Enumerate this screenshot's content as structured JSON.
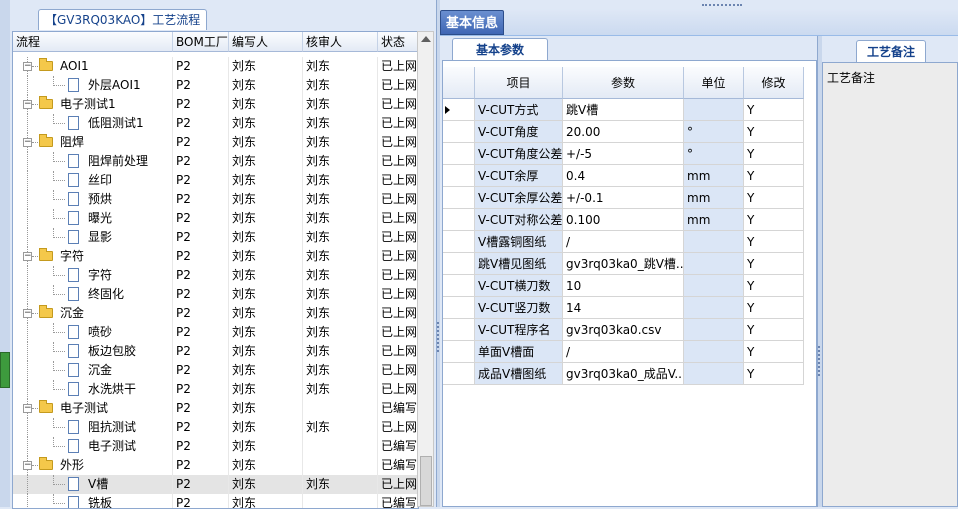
{
  "left_panel": {
    "tab_title": "【GV3RQ03KAO】工艺流程",
    "columns": [
      "流程",
      "BOM工厂",
      "编写人",
      "核审人",
      "状态"
    ],
    "rows": [
      {
        "label": "AOI1",
        "level": 1,
        "type": "folder",
        "bom": "P2",
        "author": "刘东",
        "reviewer": "刘东",
        "status": "已上网"
      },
      {
        "label": "外层AOI1",
        "level": 2,
        "type": "doc",
        "bom": "P2",
        "author": "刘东",
        "reviewer": "刘东",
        "status": "已上网"
      },
      {
        "label": "电子测试1",
        "level": 1,
        "type": "folder",
        "bom": "P2",
        "author": "刘东",
        "reviewer": "刘东",
        "status": "已上网"
      },
      {
        "label": "低阻测试1",
        "level": 2,
        "type": "doc",
        "bom": "P2",
        "author": "刘东",
        "reviewer": "刘东",
        "status": "已上网"
      },
      {
        "label": "阻焊",
        "level": 1,
        "type": "folder",
        "bom": "P2",
        "author": "刘东",
        "reviewer": "刘东",
        "status": "已上网"
      },
      {
        "label": "阻焊前处理",
        "level": 2,
        "type": "doc",
        "bom": "P2",
        "author": "刘东",
        "reviewer": "刘东",
        "status": "已上网"
      },
      {
        "label": "丝印",
        "level": 2,
        "type": "doc",
        "bom": "P2",
        "author": "刘东",
        "reviewer": "刘东",
        "status": "已上网"
      },
      {
        "label": "预烘",
        "level": 2,
        "type": "doc",
        "bom": "P2",
        "author": "刘东",
        "reviewer": "刘东",
        "status": "已上网"
      },
      {
        "label": "曝光",
        "level": 2,
        "type": "doc",
        "bom": "P2",
        "author": "刘东",
        "reviewer": "刘东",
        "status": "已上网"
      },
      {
        "label": "显影",
        "level": 2,
        "type": "doc",
        "bom": "P2",
        "author": "刘东",
        "reviewer": "刘东",
        "status": "已上网"
      },
      {
        "label": "字符",
        "level": 1,
        "type": "folder",
        "bom": "P2",
        "author": "刘东",
        "reviewer": "刘东",
        "status": "已上网"
      },
      {
        "label": "字符",
        "level": 2,
        "type": "doc",
        "bom": "P2",
        "author": "刘东",
        "reviewer": "刘东",
        "status": "已上网"
      },
      {
        "label": "终固化",
        "level": 2,
        "type": "doc",
        "bom": "P2",
        "author": "刘东",
        "reviewer": "刘东",
        "status": "已上网"
      },
      {
        "label": "沉金",
        "level": 1,
        "type": "folder",
        "bom": "P2",
        "author": "刘东",
        "reviewer": "刘东",
        "status": "已上网"
      },
      {
        "label": "喷砂",
        "level": 2,
        "type": "doc",
        "bom": "P2",
        "author": "刘东",
        "reviewer": "刘东",
        "status": "已上网"
      },
      {
        "label": "板边包胶",
        "level": 2,
        "type": "doc",
        "bom": "P2",
        "author": "刘东",
        "reviewer": "刘东",
        "status": "已上网"
      },
      {
        "label": "沉金",
        "level": 2,
        "type": "doc",
        "bom": "P2",
        "author": "刘东",
        "reviewer": "刘东",
        "status": "已上网"
      },
      {
        "label": "水洗烘干",
        "level": 2,
        "type": "doc",
        "bom": "P2",
        "author": "刘东",
        "reviewer": "刘东",
        "status": "已上网"
      },
      {
        "label": "电子测试",
        "level": 1,
        "type": "folder",
        "bom": "P2",
        "author": "刘东",
        "reviewer": "",
        "status": "已编写"
      },
      {
        "label": "阻抗测试",
        "level": 2,
        "type": "doc",
        "bom": "P2",
        "author": "刘东",
        "reviewer": "刘东",
        "status": "已上网"
      },
      {
        "label": "电子测试",
        "level": 2,
        "type": "doc",
        "bom": "P2",
        "author": "刘东",
        "reviewer": "",
        "status": "已编写"
      },
      {
        "label": "外形",
        "level": 1,
        "type": "folder",
        "bom": "P2",
        "author": "刘东",
        "reviewer": "",
        "status": "已编写"
      },
      {
        "label": "V槽",
        "level": 2,
        "type": "doc",
        "bom": "P2",
        "author": "刘东",
        "reviewer": "刘东",
        "status": "已上网",
        "selected": true
      },
      {
        "label": "铣板",
        "level": 2,
        "type": "doc",
        "bom": "P2",
        "author": "刘东",
        "reviewer": "",
        "status": "已编写"
      }
    ]
  },
  "right_panel": {
    "main_tab": "基本信息",
    "sub_tab": "基本参数",
    "columns": [
      "项目",
      "参数",
      "单位",
      "修改"
    ],
    "rows": [
      {
        "item": "V-CUT方式",
        "param": "跳V槽",
        "unit": "",
        "modify": "Y"
      },
      {
        "item": "V-CUT角度",
        "param": "20.00",
        "unit": "°",
        "modify": "Y"
      },
      {
        "item": "V-CUT角度公差",
        "param": "+/-5",
        "unit": "°",
        "modify": "Y"
      },
      {
        "item": "V-CUT余厚",
        "param": "0.4",
        "unit": "mm",
        "modify": "Y"
      },
      {
        "item": "V-CUT余厚公差",
        "param": "+/-0.1",
        "unit": "mm",
        "modify": "Y"
      },
      {
        "item": "V-CUT对称公差",
        "param": "0.100",
        "unit": "mm",
        "modify": "Y"
      },
      {
        "item": "V槽露铜图纸",
        "param": "/",
        "unit": "",
        "modify": "Y"
      },
      {
        "item": "跳V槽见图纸",
        "param": "gv3rq03ka0_跳V槽...",
        "unit": "",
        "modify": "Y"
      },
      {
        "item": "V-CUT横刀数",
        "param": "10",
        "unit": "",
        "modify": "Y"
      },
      {
        "item": "V-CUT竖刀数",
        "param": "14",
        "unit": "",
        "modify": "Y"
      },
      {
        "item": "V-CUT程序名",
        "param": "gv3rq03ka0.csv",
        "unit": "",
        "modify": "Y"
      },
      {
        "item": "单面V槽面",
        "param": "/",
        "unit": "",
        "modify": "Y"
      },
      {
        "item": "成品V槽图纸",
        "param": "gv3rq03ka0_成品V...",
        "unit": "",
        "modify": "Y"
      }
    ]
  },
  "note_panel": {
    "tab": "工艺备注",
    "label": "工艺备注"
  }
}
